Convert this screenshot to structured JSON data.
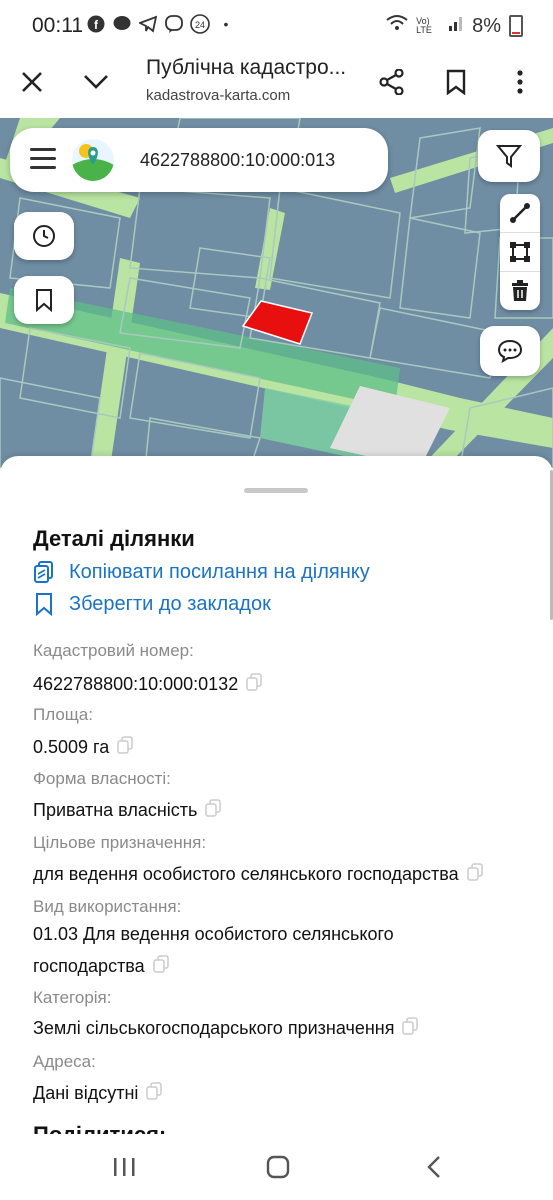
{
  "status_bar": {
    "time": "00:11",
    "notification_icons": [
      "facebook-icon",
      "messenger-icon",
      "telegram-icon",
      "viber-icon",
      "news-24-icon"
    ],
    "dot": "•",
    "network_label": "Vo) LTE",
    "battery": "8%"
  },
  "browser": {
    "title": "Публічна кадастро...",
    "url": "kadastrova-karta.com"
  },
  "search": {
    "cadastral_number": "4622788800:10:000:013"
  },
  "sheet": {
    "title": "Деталі ділянки",
    "copy_link": "Копіювати посилання на ділянку",
    "save_bookmark": "Зберегти до закладок",
    "fields": [
      {
        "label": "Кадастровий номер:",
        "value": "4622788800:10:000:0132"
      },
      {
        "label": "Площа:",
        "value": "0.5009 га"
      },
      {
        "label": "Форма власності:",
        "value": "Приватна власність"
      },
      {
        "label": "Цільове призначення:",
        "value": "для ведення особистого селянського господарства"
      },
      {
        "label": "Вид використання:",
        "value_line1": "01.03 Для ведення особистого селянського",
        "value_line2": "господарства"
      },
      {
        "label": "Категорія:",
        "value": "Землі сільськогосподарського призначення"
      },
      {
        "label": "Адреса:",
        "value": "Дані відсутні"
      }
    ],
    "next_heading": "Поділитися:"
  },
  "colors": {
    "accent": "#1a73c4",
    "selected_parcel": "#e8100f",
    "parcel": "#6f8da3",
    "road": "#b9e4a1"
  }
}
